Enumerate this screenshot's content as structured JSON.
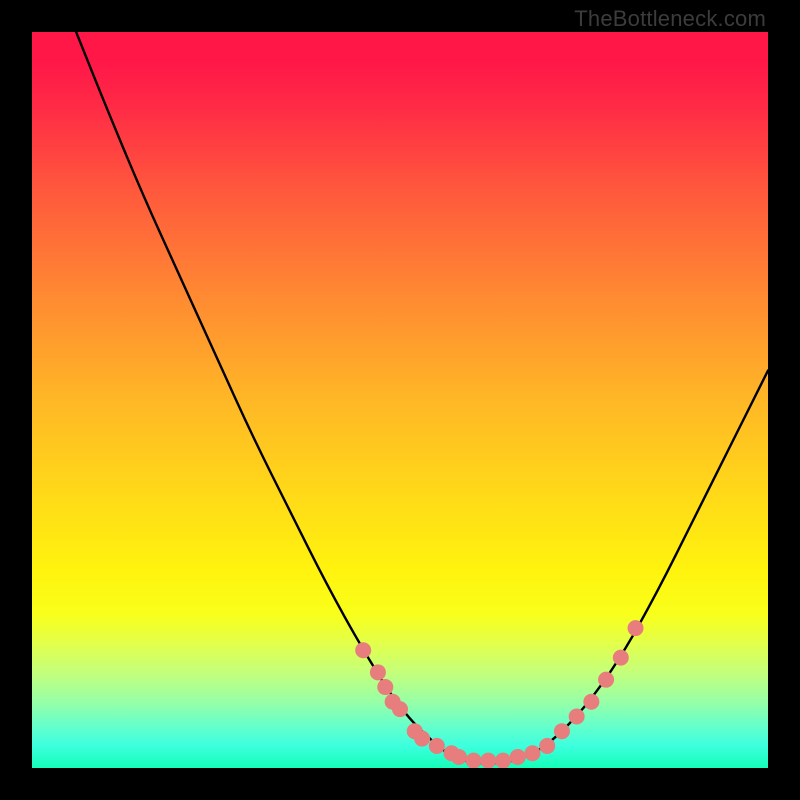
{
  "watermark": "TheBottleneck.com",
  "chart_data": {
    "type": "line",
    "title": "",
    "xlabel": "",
    "ylabel": "",
    "xlim": [
      0,
      100
    ],
    "ylim": [
      0,
      100
    ],
    "grid": false,
    "legend": false,
    "series": [
      {
        "name": "bottleneck-curve",
        "color": "#000000",
        "points": [
          {
            "x": 6,
            "y": 100
          },
          {
            "x": 10,
            "y": 90
          },
          {
            "x": 15,
            "y": 78
          },
          {
            "x": 20,
            "y": 67
          },
          {
            "x": 25,
            "y": 56
          },
          {
            "x": 30,
            "y": 45
          },
          {
            "x": 35,
            "y": 35
          },
          {
            "x": 40,
            "y": 25
          },
          {
            "x": 45,
            "y": 16
          },
          {
            "x": 50,
            "y": 8
          },
          {
            "x": 55,
            "y": 3
          },
          {
            "x": 58,
            "y": 1
          },
          {
            "x": 62,
            "y": 0.5
          },
          {
            "x": 66,
            "y": 1
          },
          {
            "x": 70,
            "y": 3
          },
          {
            "x": 75,
            "y": 8
          },
          {
            "x": 80,
            "y": 15
          },
          {
            "x": 85,
            "y": 24
          },
          {
            "x": 90,
            "y": 34
          },
          {
            "x": 95,
            "y": 44
          },
          {
            "x": 100,
            "y": 54
          }
        ]
      }
    ],
    "markers": {
      "name": "highlight-dots",
      "color": "#e77d7d",
      "radius": 8,
      "points": [
        {
          "x": 45,
          "y": 16
        },
        {
          "x": 47,
          "y": 13
        },
        {
          "x": 48,
          "y": 11
        },
        {
          "x": 49,
          "y": 9
        },
        {
          "x": 50,
          "y": 8
        },
        {
          "x": 52,
          "y": 5
        },
        {
          "x": 53,
          "y": 4
        },
        {
          "x": 55,
          "y": 3
        },
        {
          "x": 57,
          "y": 2
        },
        {
          "x": 58,
          "y": 1.5
        },
        {
          "x": 60,
          "y": 1
        },
        {
          "x": 62,
          "y": 1
        },
        {
          "x": 64,
          "y": 1
        },
        {
          "x": 66,
          "y": 1.5
        },
        {
          "x": 68,
          "y": 2
        },
        {
          "x": 70,
          "y": 3
        },
        {
          "x": 72,
          "y": 5
        },
        {
          "x": 74,
          "y": 7
        },
        {
          "x": 76,
          "y": 9
        },
        {
          "x": 78,
          "y": 12
        },
        {
          "x": 80,
          "y": 15
        },
        {
          "x": 82,
          "y": 19
        }
      ]
    }
  }
}
